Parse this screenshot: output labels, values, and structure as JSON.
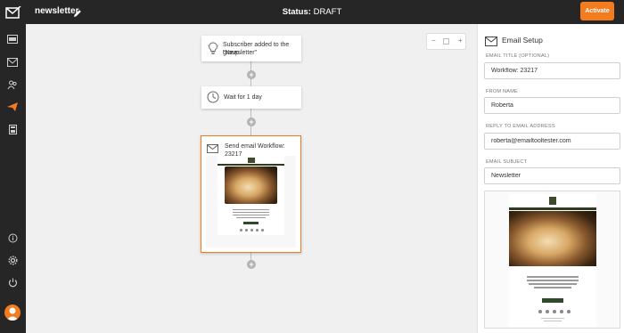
{
  "header": {
    "title": "newsletter",
    "status_label": "Status:",
    "status_value": "DRAFT",
    "activate_label": "Activate"
  },
  "sidebar": {
    "items": [
      {
        "icon": "dashboard-icon"
      },
      {
        "icon": "mail-icon"
      },
      {
        "icon": "subscribers-icon"
      },
      {
        "icon": "automation-icon",
        "active": true
      },
      {
        "icon": "calculator-icon"
      },
      {
        "icon": "info-icon"
      },
      {
        "icon": "settings-icon"
      },
      {
        "icon": "power-icon"
      }
    ],
    "active_color": "#f47c20"
  },
  "canvas": {
    "zoom": {
      "minus": "−",
      "plus": "+"
    },
    "workflow": [
      {
        "icon": "lightbulb-icon",
        "text_line1": "Subscriber added to the group",
        "text_line2": "\"Newsletter\""
      },
      {
        "icon": "clock-icon",
        "text": "Wait for 1 day"
      },
      {
        "icon": "envelope-icon",
        "text": "Send email Workflow: 23217",
        "selected": true
      }
    ]
  },
  "email_setup": {
    "title": "Email Setup",
    "fields": [
      {
        "label": "EMAIL TITLE (OPTIONAL)",
        "value": "Workflow: 23217"
      },
      {
        "label": "FROM NAME",
        "value": "Roberta"
      },
      {
        "label": "REPLY TO EMAIL ADDRESS",
        "value": "roberta@emailtooltester.com"
      },
      {
        "label": "EMAIL SUBJECT",
        "value": "Newsletter"
      }
    ]
  },
  "colors": {
    "accent": "#f47c20",
    "dark_bar": "#262626",
    "canvas_bg": "#f0f0f0"
  }
}
